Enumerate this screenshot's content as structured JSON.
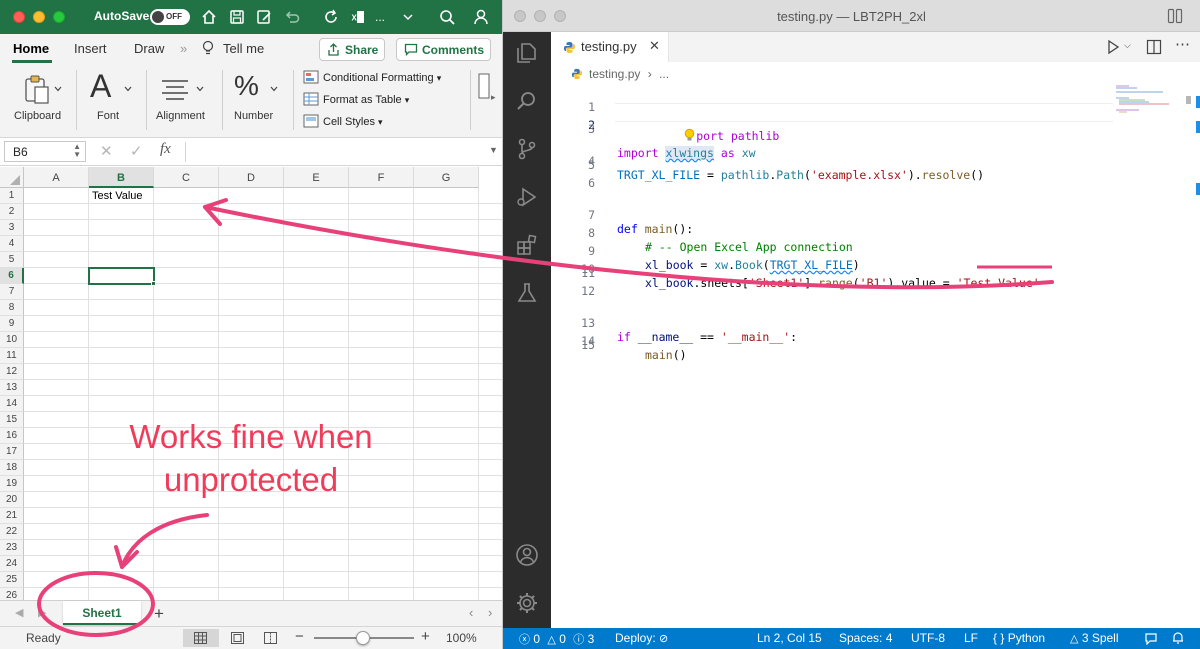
{
  "excel": {
    "title_bar": {
      "autosave_label": "AutoSave",
      "autosave_state": "OFF",
      "doc_label": "..."
    },
    "tabs": [
      "Home",
      "Insert",
      "Draw",
      "Tell me"
    ],
    "more_tabs_glyph": "»",
    "share_label": "Share",
    "comments_label": "Comments",
    "ribbon": {
      "clipboard": "Clipboard",
      "font": "Font",
      "alignment": "Alignment",
      "number": "Number",
      "conditional_formatting": "Conditional Formatting",
      "format_as_table": "Format as Table",
      "cell_styles": "Cell Styles"
    },
    "formula_bar": {
      "name_box": "B6",
      "fx": "fx",
      "content": ""
    },
    "columns": [
      "A",
      "B",
      "C",
      "D",
      "E",
      "F",
      "G"
    ],
    "selected_column": "B",
    "rows": [
      "1",
      "2",
      "3",
      "4",
      "5",
      "6",
      "7",
      "8",
      "9",
      "10",
      "11",
      "12",
      "13",
      "14",
      "15",
      "16",
      "17",
      "18",
      "19",
      "20",
      "21",
      "22",
      "23",
      "24",
      "25",
      "26"
    ],
    "selected_row": "6",
    "cells": {
      "B1": "Test Value"
    },
    "sheet_tab": "Sheet1",
    "add_sheet": "+",
    "status": {
      "ready": "Ready",
      "zoom": "100%"
    },
    "brand_color": "#217346"
  },
  "vscode": {
    "window_title": "testing.py — LBT2PH_2xl",
    "tab_label": "testing.py",
    "breadcrumb_file": "testing.py",
    "breadcrumb_more": "...",
    "line_numbers": [
      "1",
      "2",
      "3",
      "4",
      "5",
      "6",
      "7",
      "8",
      "9",
      "10",
      "11",
      "12",
      "13",
      "14",
      "15"
    ],
    "current_line": "2",
    "code": {
      "l1_rest": "port pathlib",
      "l2_import": "import",
      "l2_mod": "xlwings",
      "l2_as": "as",
      "l2_alias": "xw",
      "l4_var": "TRGT_XL_FILE",
      "l4_eq": " = ",
      "l4_mod": "pathlib",
      "l4_dot": ".",
      "l4_cls": "Path",
      "l4_open": "(",
      "l4_str": "'example.xlsx'",
      "l4_close": ").",
      "l4_fn": "resolve",
      "l4_end": "()",
      "l7_def": "def",
      "l7_fn": "main",
      "l7_end": "():",
      "l8_comment": "# -- Open Excel App connection",
      "l9_var": "xl_book",
      "l9_eq": " = ",
      "l9_mod": "xw",
      "l9_dot": ".",
      "l9_fn": "Book",
      "l9_open": "(",
      "l9_arg": "TRGT_XL_FILE",
      "l9_close": ")",
      "l10_var": "xl_book",
      "l10_a": ".sheets[",
      "l10_s1": "'Sheet1'",
      "l10_b": "].",
      "l10_fn": "range",
      "l10_c": "(",
      "l10_s2": "'B1'",
      "l10_d": ").value = ",
      "l10_s3": "'Test Value'",
      "l13_if": "if",
      "l13_name": "__name__",
      "l13_eq": " == ",
      "l13_str": "'__main__'",
      "l13_colon": ":",
      "l14_fn": "main",
      "l14_end": "()"
    },
    "status": {
      "errors": "0",
      "warnings": "0",
      "info": "3",
      "deploy": "Deploy:",
      "position": "Ln 2, Col 15",
      "spaces": "Spaces: 4",
      "encoding": "UTF-8",
      "eol": "LF",
      "braces": "{ }",
      "language": "Python",
      "spell": "3 Spell"
    },
    "status_color": "#007acc"
  },
  "annotation": {
    "line1": "Works fine when",
    "line2": "unprotected",
    "color": "#f03c5a"
  }
}
